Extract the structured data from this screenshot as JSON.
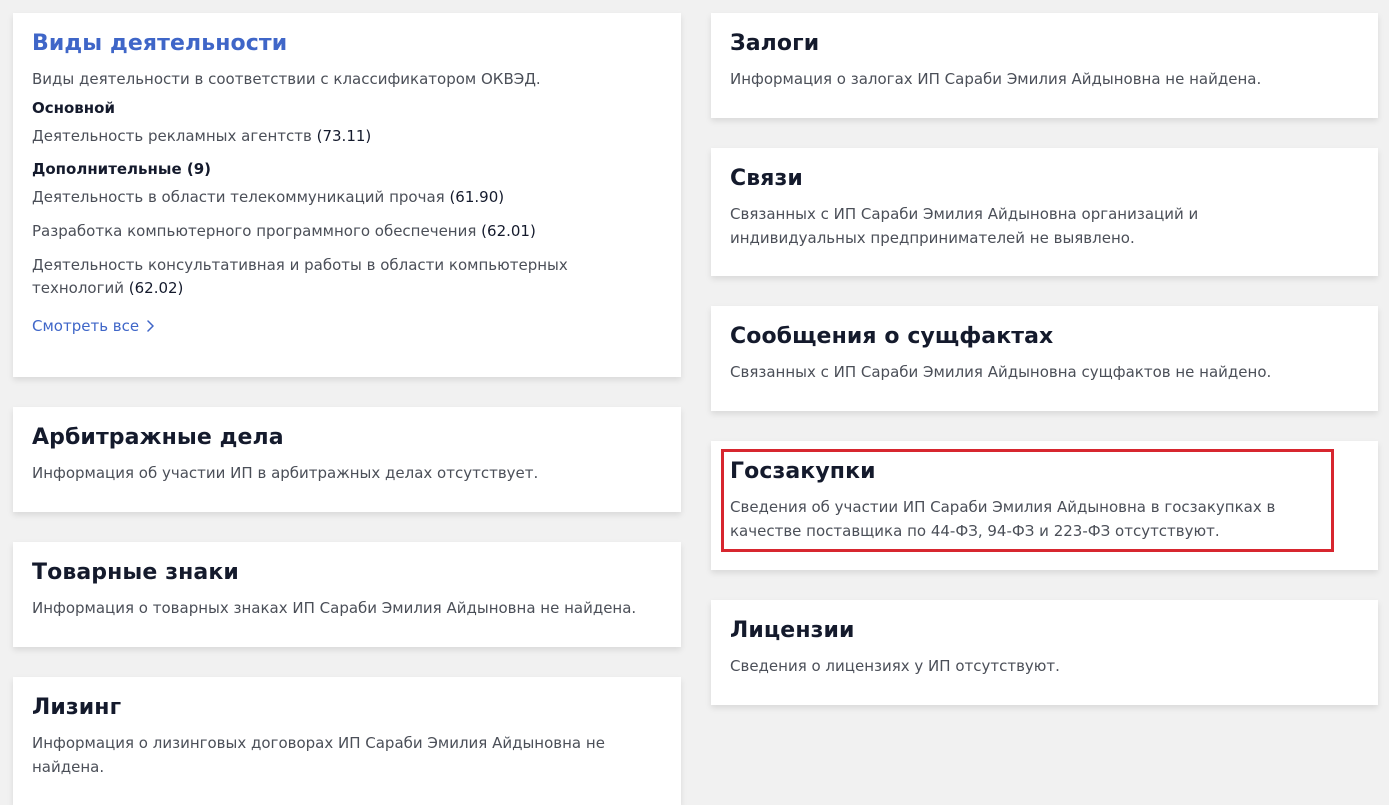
{
  "left": {
    "activities": {
      "title": "Виды деятельности",
      "description": "Виды деятельности в соответствии с классификатором ОКВЭД.",
      "main_label": "Основной",
      "main_item": {
        "text": "Деятельность рекламных агентств",
        "code": "(73.11)"
      },
      "extra_label": "Дополнительные (9)",
      "extra_items": [
        {
          "text": "Деятельность в области телекоммуникаций прочая",
          "code": "(61.90)"
        },
        {
          "text": "Разработка компьютерного программного обеспечения",
          "code": "(62.01)"
        },
        {
          "text": "Деятельность консультативная и работы в области компьютерных технологий",
          "code": "(62.02)"
        }
      ],
      "see_all": "Смотреть все"
    },
    "arbitration": {
      "title": "Арбитражные дела",
      "text": "Информация об участии ИП в арбитражных делах отсутствует."
    },
    "trademarks": {
      "title": "Товарные знаки",
      "text": "Информация о товарных знаках ИП Сараби Эмилия Айдыновна не найдена."
    },
    "leasing": {
      "title": "Лизинг",
      "text": "Информация о лизинговых договорах ИП Сараби Эмилия Айдыновна не найдена."
    }
  },
  "right": {
    "pledges": {
      "title": "Залоги",
      "text": "Информация о залогах ИП Сараби Эмилия Айдыновна не найдена."
    },
    "links": {
      "title": "Связи",
      "text": "Связанных с ИП Сараби Эмилия Айдыновна организаций и индивидуальных предпринимателей не выявлено."
    },
    "facts": {
      "title": "Сообщения о сущфактах",
      "text": "Связанных с ИП Сараби Эмилия Айдыновна сущфактов не найдено."
    },
    "procurement": {
      "title": "Госзакупки",
      "text": "Сведения об участии ИП Сараби Эмилия Айдыновна в госзакупках в качестве поставщика по 44-ФЗ, 94-ФЗ и 223-ФЗ отсутствуют."
    },
    "licenses": {
      "title": "Лицензии",
      "text": "Сведения о лицензиях у ИП отсутствуют."
    }
  },
  "colors": {
    "accent": "#3f66c8",
    "highlight": "#d7262f",
    "background": "#f1f1f1"
  },
  "icons": {
    "see_all": "chevron-right-icon"
  }
}
